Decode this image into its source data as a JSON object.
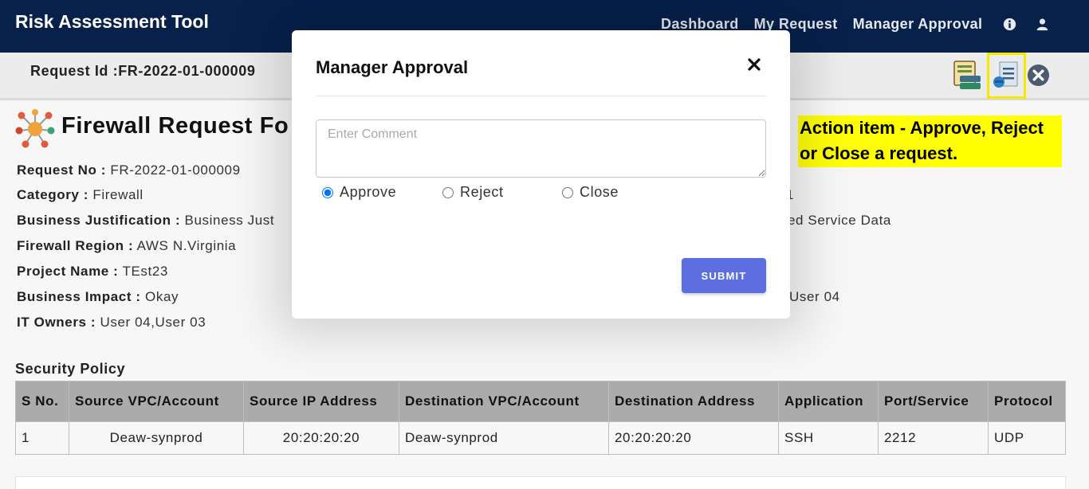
{
  "app": {
    "title": "Risk Assessment Tool"
  },
  "nav": {
    "items": [
      "Dashboard",
      "My Request",
      "Manager Approval"
    ],
    "info_icon": "info-circle-icon",
    "user_icon": "user-icon"
  },
  "request_bar": {
    "request_id": "Request Id :FR-2022-01-000009",
    "icons": [
      "stack-document-icon",
      "document-approval-icon",
      "close-circle-icon"
    ]
  },
  "form": {
    "title": "Firewall Request Fo",
    "fields": [
      {
        "label": "Request No :",
        "value": " FR-2022-01-000009"
      },
      {
        "label": "Category :",
        "value": " Firewall"
      },
      {
        "label": "Business Justification :",
        "value": " Business Just"
      },
      {
        "label": "Firewall Region :",
        "value": " AWS N.Virginia"
      },
      {
        "label": "Project Name :",
        "value": " TEst23"
      },
      {
        "label": "Business Impact :",
        "value": " Okay"
      },
      {
        "label": "IT Owners :",
        "value": " User 04,User 03"
      }
    ],
    "right_fragments": [
      "1",
      "ed Service Data",
      "User 04"
    ]
  },
  "callout": {
    "text": "Action item - Approve, Reject or Close a request."
  },
  "security_policy": {
    "title": "Security Policy",
    "columns": [
      "S No.",
      "Source VPC/Account",
      "Source IP Address",
      "Destination VPC/Account",
      "Destination Address",
      "Application",
      "Port/Service",
      "Protocol"
    ],
    "rows": [
      [
        "1",
        "Deaw-synprod",
        "20:20:20:20",
        "Deaw-synprod",
        "20:20:20:20",
        "SSH",
        "2212",
        "UDP"
      ]
    ]
  },
  "modal": {
    "title": "Manager Approval",
    "comment_placeholder": "Enter Comment",
    "options": [
      "Approve",
      "Reject",
      "Close"
    ],
    "selected": "Approve",
    "submit_label": "SUBMIT"
  },
  "colors": {
    "navbar": "#07214b",
    "submit": "#5c6ee0",
    "callout": "#ffff00",
    "highlight": "#f3ea00"
  }
}
